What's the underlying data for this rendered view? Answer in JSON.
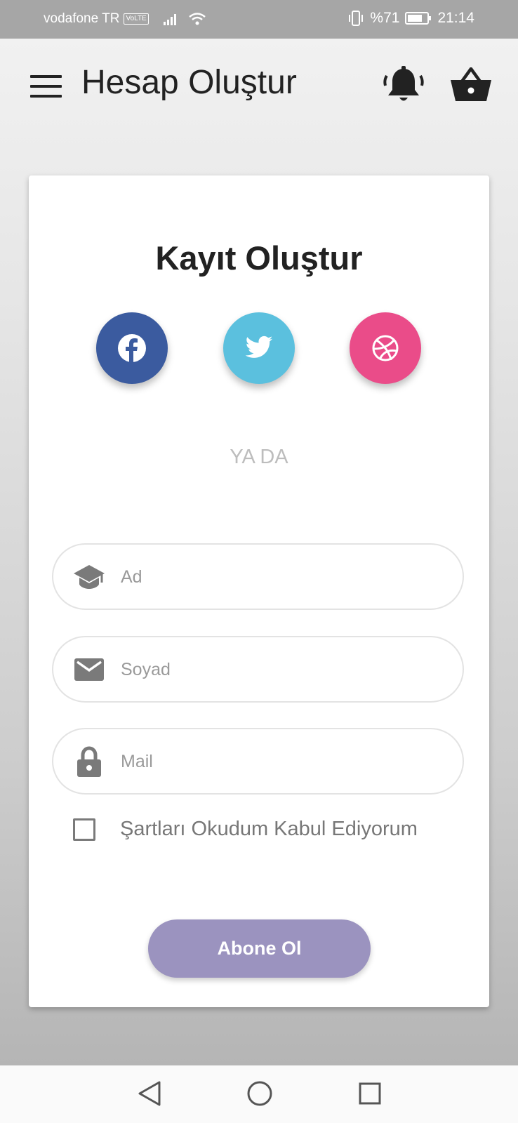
{
  "status_bar": {
    "carrier": "vodafone TR",
    "volte": "VoLTE",
    "battery": "%71",
    "time": "21:14"
  },
  "app_bar": {
    "title": "Hesap Oluştur"
  },
  "card": {
    "title": "Kayıt Oluştur",
    "social": {
      "facebook_color": "#3b5b9f",
      "twitter_color": "#5bc0de",
      "dribbble_color": "#ea4c89"
    },
    "divider_text": "YA DA",
    "fields": {
      "first_name_placeholder": "Ad",
      "last_name_placeholder": "Soyad",
      "mail_placeholder": "Mail"
    },
    "terms_label": "Şartları Okudum Kabul Ediyorum",
    "terms_checked": false,
    "submit_label": "Abone Ol",
    "submit_color": "#9b93bf"
  },
  "icons": [
    "menu-icon",
    "bell-icon",
    "basket-icon",
    "facebook-icon",
    "twitter-icon",
    "dribbble-icon",
    "graduation-cap-icon",
    "mail-icon",
    "lock-icon",
    "back-icon",
    "home-icon",
    "recents-icon"
  ]
}
